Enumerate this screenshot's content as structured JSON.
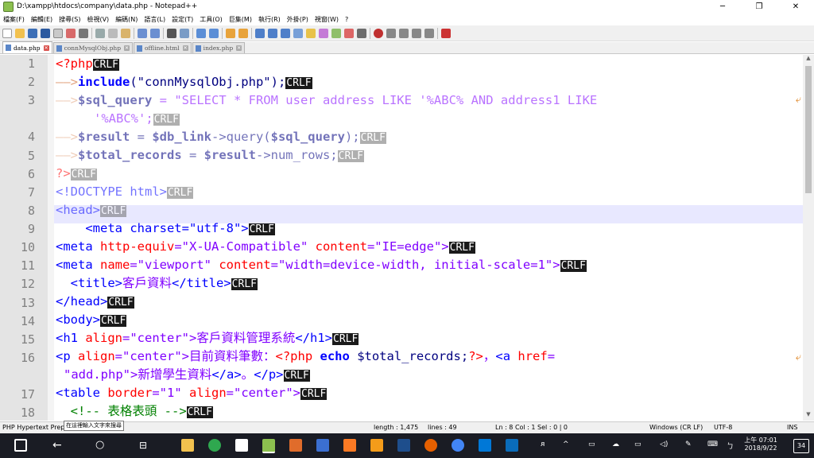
{
  "window": {
    "title": "D:\\xampp\\htdocs\\company\\data.php - Notepad++",
    "minimize": "─",
    "maximize": "❐",
    "close": "✕"
  },
  "menu": [
    "檔案(F)",
    "編輯(E)",
    "搜尋(S)",
    "檢視(V)",
    "編碼(N)",
    "語言(L)",
    "設定(T)",
    "工具(O)",
    "巨集(M)",
    "執行(R)",
    "外掛(P)",
    "視窗(W)",
    "?"
  ],
  "tabs": [
    {
      "label": "data.php",
      "active": true
    },
    {
      "label": "connMysqlObj.php",
      "active": false
    },
    {
      "label": "offline.html",
      "active": false
    },
    {
      "label": "index.php",
      "active": false
    }
  ],
  "editor": {
    "line_numbers": [
      "1",
      "2",
      "3",
      "",
      "4",
      "5",
      "6",
      "7",
      "8",
      "9",
      "10",
      "11",
      "12",
      "13",
      "14",
      "15",
      "16",
      "",
      "17",
      "18"
    ],
    "current_line": 8,
    "lines": {
      "l1a": "<?php",
      "l2a": "include",
      "l2b": "(\"connMysqlObj.php\");",
      "l3a": "$sql_query",
      "l3b": " = \"SELECT * FROM user address LIKE '%ABC% AND address1 LIKE ",
      "l3c": "'%ABC%';",
      "l4a": "$result",
      "l4b": " = ",
      "l4c": "$db_link",
      "l4d": "->query(",
      "l4e": "$sql_query",
      "l4f": ");",
      "l5a": "$total_records",
      "l5b": " = ",
      "l5c": "$result",
      "l5d": "->num_rows;",
      "l6a": "?>",
      "l7a": "<!DOCTYPE html>",
      "l8a": "<head>",
      "l9a": "    <meta charset=\"utf-8\">",
      "l10a": "<meta ",
      "l10b": "http-equiv",
      "l10c": "=\"X-UA-Compatible\" ",
      "l10d": "content",
      "l10e": "=\"IE=edge\">",
      "l11a": "<meta ",
      "l11b": "name",
      "l11c": "=\"viewport\" ",
      "l11d": "content",
      "l11e": "=\"width=device-width, initial-scale=1\">",
      "l12a": "  <title>",
      "l12b": "客戶資料",
      "l12c": "</title>",
      "l13a": "</head>",
      "l14a": "<body>",
      "l15a": "<h1 ",
      "l15b": "align",
      "l15c": "=\"center\">",
      "l15d": "客戶資料管理系統",
      "l15e": "</h1>",
      "l16a": "<p ",
      "l16b": "align",
      "l16c": "=\"center\">",
      "l16d": "目前資料筆數：",
      "l16e": "<?php ",
      "l16f": "echo ",
      "l16g": "$total_records",
      "l16h": ";",
      "l16i": "?>",
      "l16j": "，",
      "l16k": "<a ",
      "l16l": "href",
      "l16m": "=",
      "l16n": "\"add.php\">",
      "l16o": "新增學生資料",
      "l16p": "</a>",
      "l16q": "。",
      "l16r": "</p>",
      "l17a": "<table ",
      "l17b": "border",
      "l17c": "=\"1\" ",
      "l17d": "align",
      "l17e": "=\"center\">",
      "l18a": "  <!-- 表格表頭 -->",
      "crlf": "CRLF",
      "tab_arrow": "——>"
    }
  },
  "status": {
    "type": "PHP Hypertext Prep",
    "length": "length : 1,475",
    "lines": "lines : 49",
    "pos": "Ln : 8    Col : 1    Sel : 0 | 0",
    "eol": "Windows (CR LF)",
    "encoding": "UTF-8",
    "mode": "INS",
    "tooltip": "在這裡輸入文字來搜尋"
  },
  "taskbar": {
    "time": "上午 07:01",
    "date": "2018/9/22",
    "lang": "ㄅ",
    "notif": "34"
  }
}
